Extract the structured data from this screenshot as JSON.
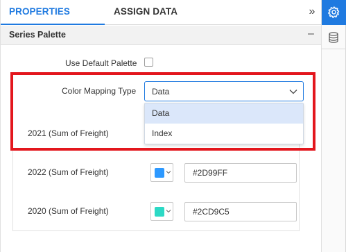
{
  "tabs": {
    "properties": "PROPERTIES",
    "assign_data": "ASSIGN DATA",
    "collapse_icon": "»"
  },
  "section": {
    "title": "Series Palette",
    "toggle": "–"
  },
  "fields": {
    "use_default_palette_label": "Use Default Palette",
    "use_default_palette_checked": false,
    "color_mapping_label": "Color Mapping Type",
    "color_mapping_value": "Data",
    "color_mapping_options": [
      "Data",
      "Index"
    ],
    "color_mapping_selected_option": "Data"
  },
  "series": [
    {
      "label": "2021 (Sum of Freight)"
    },
    {
      "label": "2022 (Sum of Freight)",
      "color": "#2D99FF",
      "hex": "#2D99FF"
    },
    {
      "label": "2020 (Sum of Freight)",
      "color": "#2CD9C5",
      "hex": "#2CD9C5"
    }
  ],
  "rail": {
    "settings_icon": "gear-icon",
    "database_icon": "database-icon"
  },
  "colors": {
    "accent": "#1f7ae0",
    "highlight": "#e3161d",
    "option_selected_bg": "#dbe7fa"
  }
}
